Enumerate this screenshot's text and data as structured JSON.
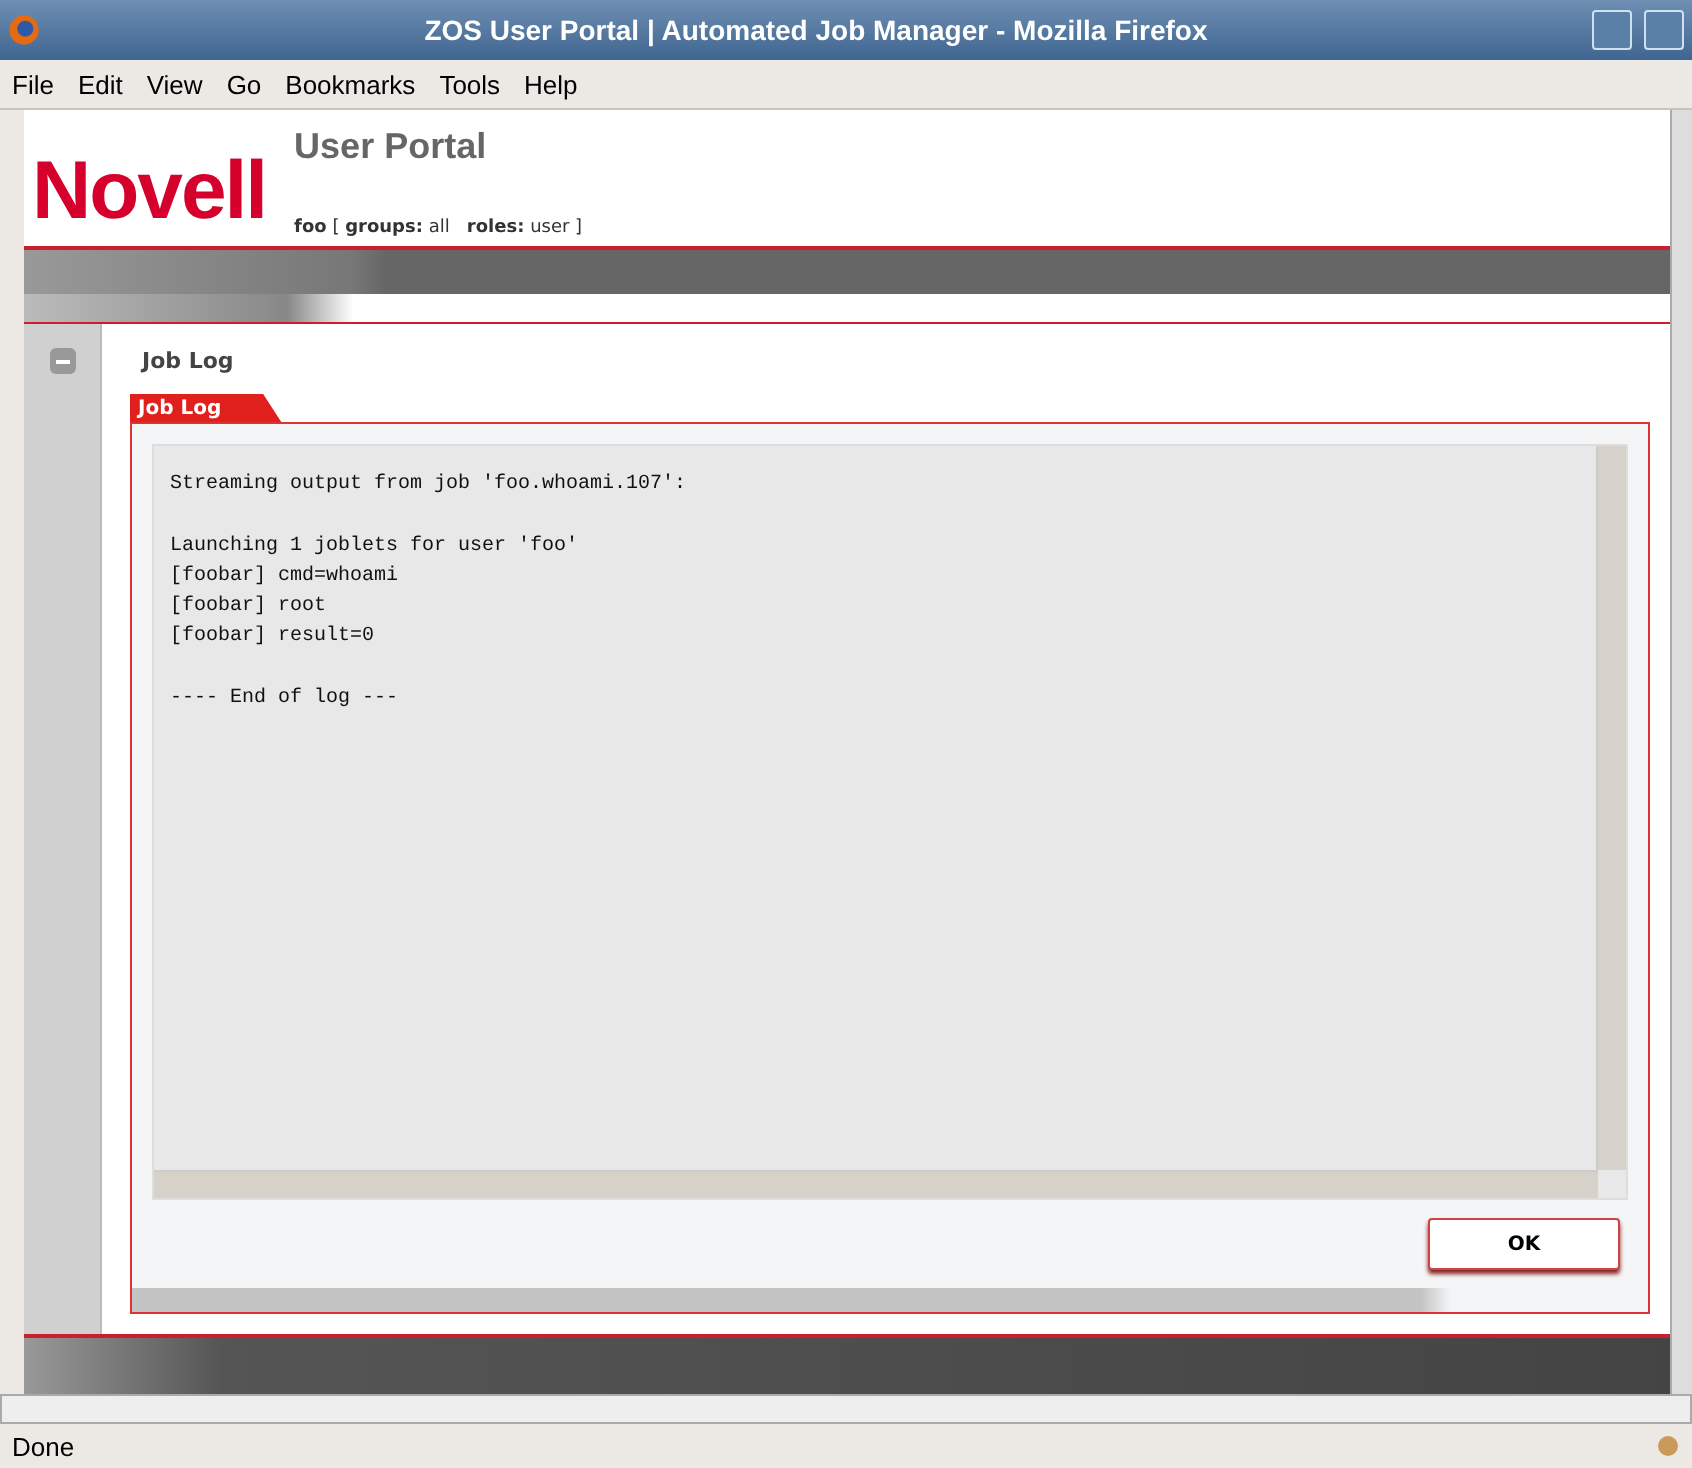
{
  "window": {
    "title": "ZOS User Portal | Automated Job Manager - Mozilla Firefox"
  },
  "menu": [
    "File",
    "Edit",
    "View",
    "Go",
    "Bookmarks",
    "Tools",
    "Help"
  ],
  "header": {
    "logo": "Novell",
    "title": "User Portal",
    "user_line": "**foo** [ **groups:** all   **roles:** user ]"
  },
  "section": {
    "title": "Job Log",
    "tab": "Job Log",
    "log_blocks": [
      [
        "Streaming output from job 'foo.whoami.107':"
      ],
      [
        "Launching 1 joblets for user 'foo'",
        "[foobar] cmd=whoami",
        "[foobar] root",
        "[foobar] result=0"
      ],
      [
        "---- End of log ---"
      ]
    ],
    "expanded": true,
    "ok_button": "OK"
  },
  "status_bar": {
    "text": "Done"
  }
}
